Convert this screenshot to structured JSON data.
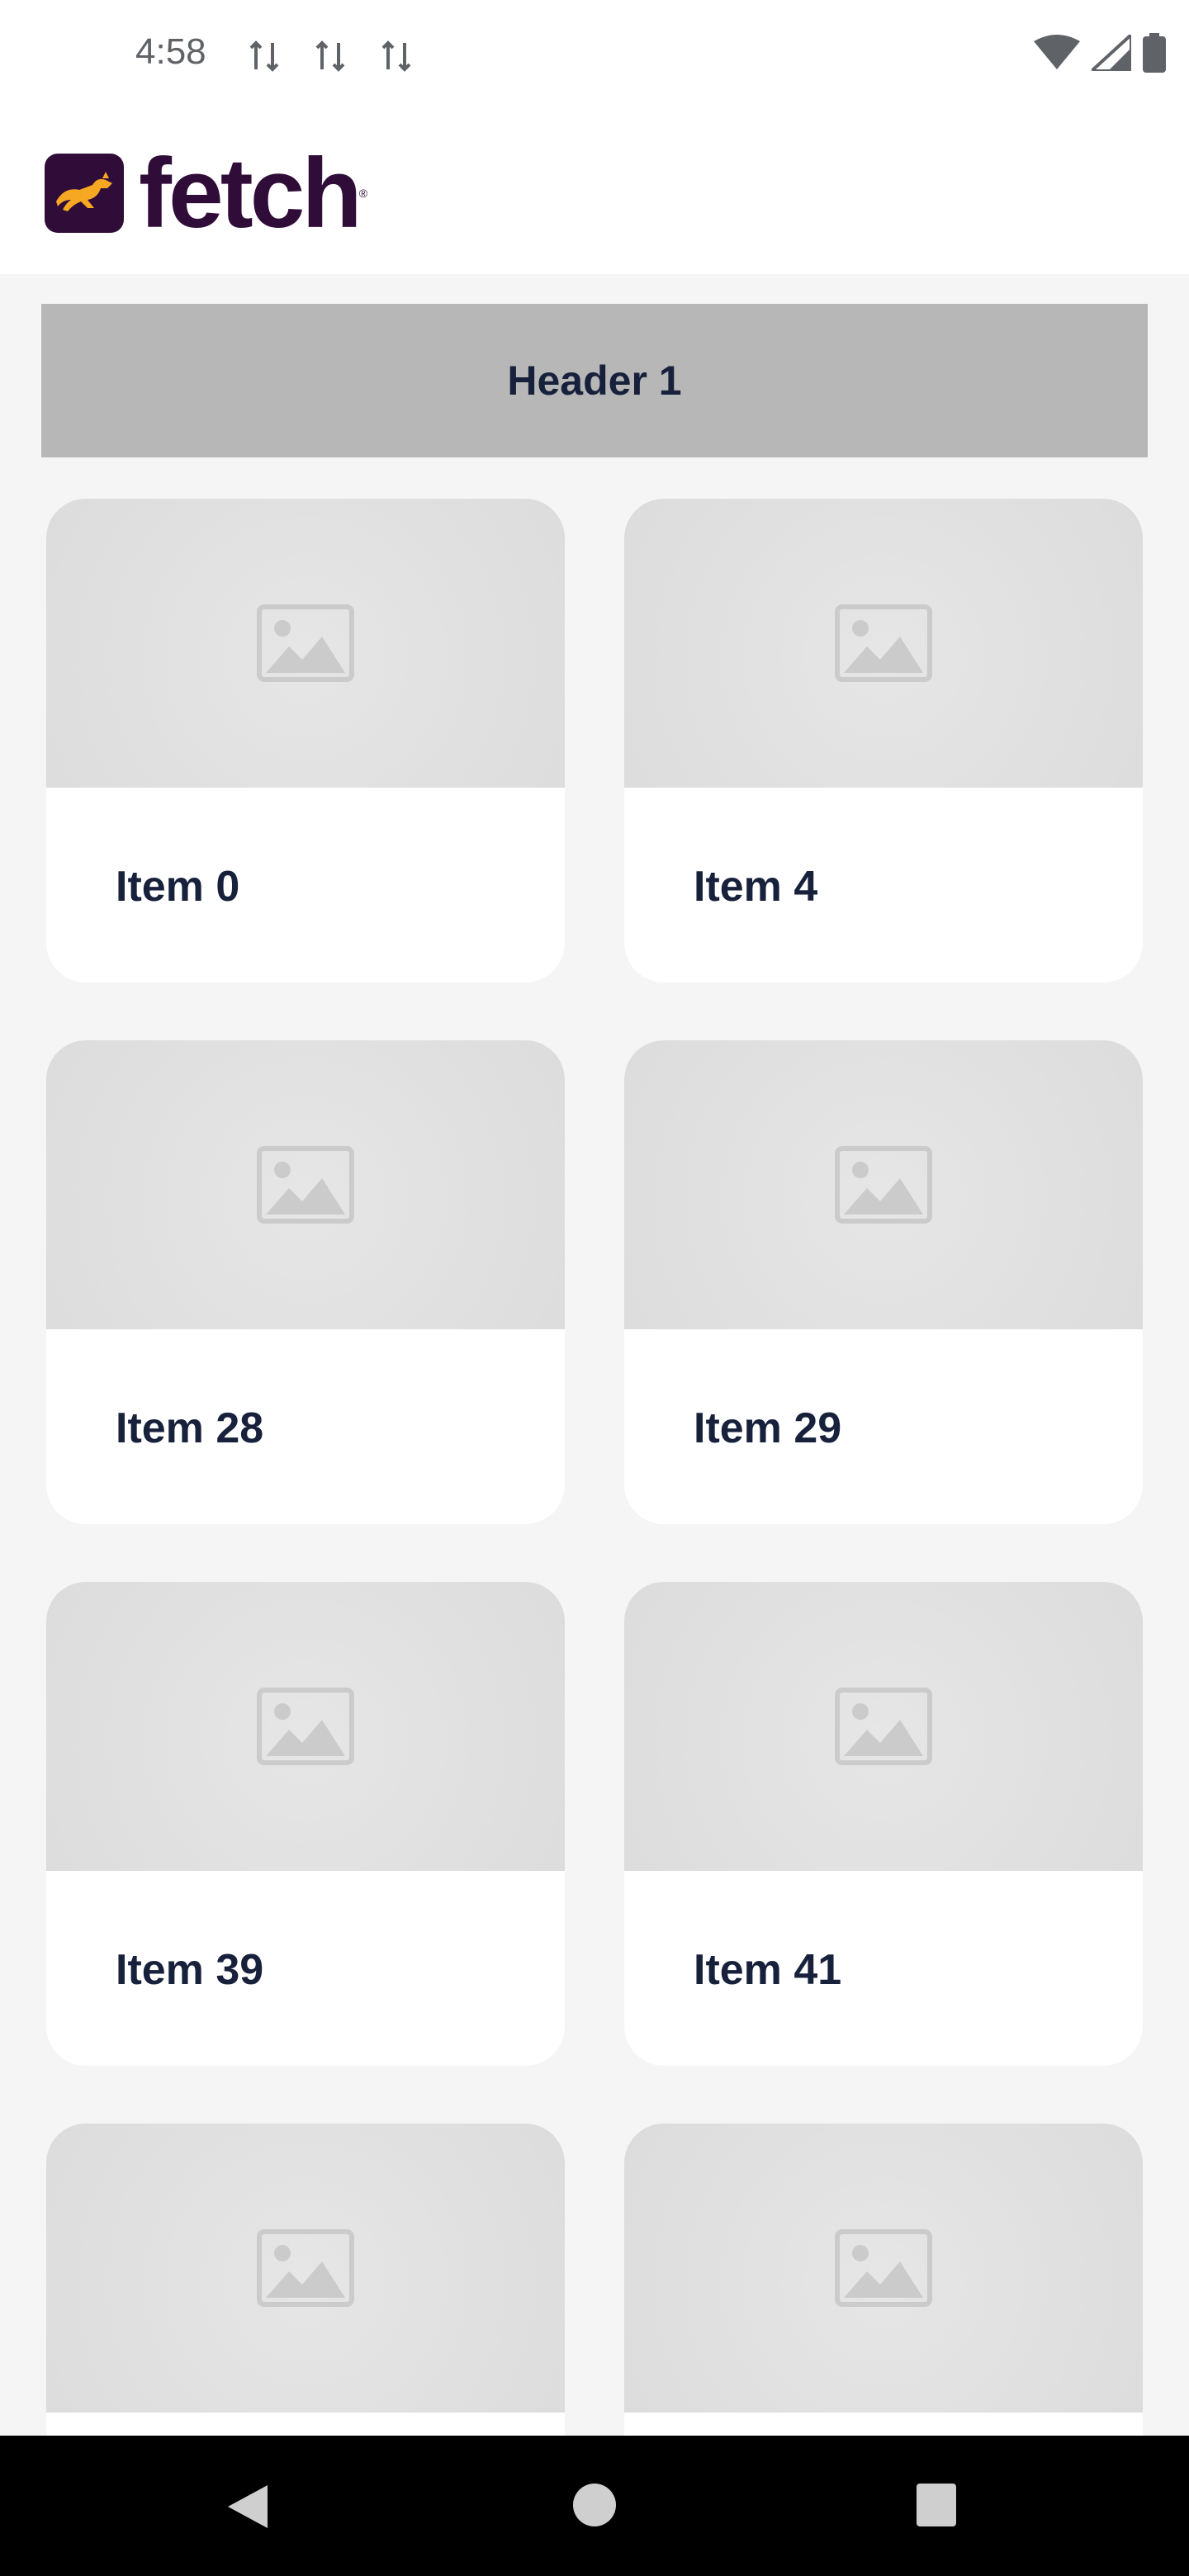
{
  "status_bar": {
    "time": "4:58",
    "icons": [
      "data-transfer-icon",
      "data-transfer-icon",
      "data-transfer-icon",
      "wifi-icon",
      "cell-signal-icon",
      "battery-icon"
    ]
  },
  "app_bar": {
    "logo_text": "fetch",
    "logo_mark": "®",
    "brand_color": "#300d38",
    "accent_color": "#f7a823"
  },
  "header": {
    "title": "Header 1"
  },
  "items": [
    {
      "label": "Item 0",
      "image": "image-placeholder-icon"
    },
    {
      "label": "Item 4",
      "image": "image-placeholder-icon"
    },
    {
      "label": "Item 28",
      "image": "image-placeholder-icon"
    },
    {
      "label": "Item 29",
      "image": "image-placeholder-icon"
    },
    {
      "label": "Item 39",
      "image": "image-placeholder-icon"
    },
    {
      "label": "Item 41",
      "image": "image-placeholder-icon"
    },
    {
      "label": "",
      "image": "image-placeholder-icon"
    },
    {
      "label": "",
      "image": "image-placeholder-icon"
    }
  ],
  "nav_bar": {
    "buttons": [
      "back-icon",
      "home-icon",
      "recents-icon"
    ]
  }
}
